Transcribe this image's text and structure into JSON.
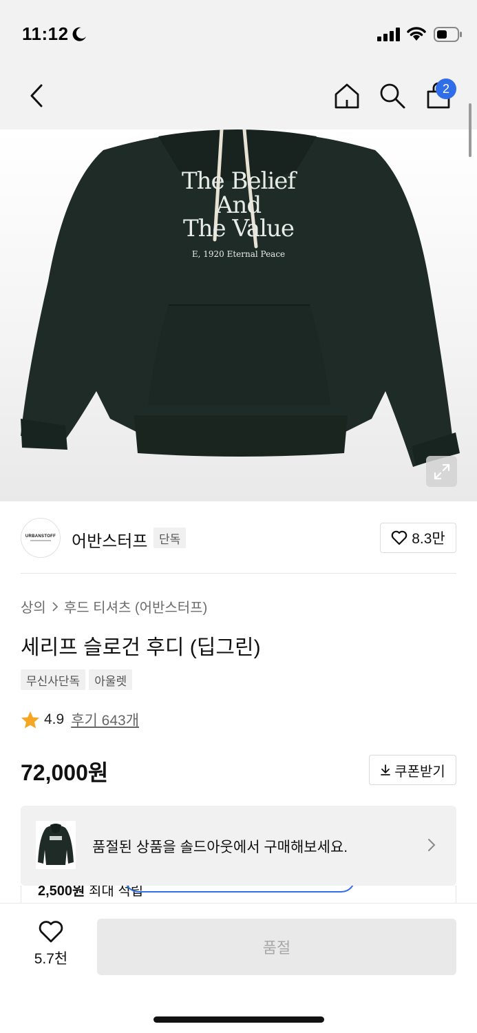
{
  "status_bar": {
    "time": "11:12"
  },
  "cart": {
    "badge_count": "2"
  },
  "product_image": {
    "print_line_1": "The Belief",
    "print_line_2": "And",
    "print_line_3": "The Value",
    "print_line_4": "E, 1920 Eternal Peace"
  },
  "brand": {
    "logo_text": "URBANSTOFF",
    "name": "어반스터프",
    "tag": "단독",
    "like_count": "8.3만"
  },
  "breadcrumb": {
    "category": "상의",
    "subcategory": "후드 티셔츠 (어반스터프)"
  },
  "product": {
    "title": "세리프 슬로건 후디 (딥그린)",
    "tags": [
      "무신사단독",
      "아울렛"
    ],
    "rating": "4.9",
    "review_link": "후기 643개",
    "price": "72,000원",
    "coupon_label": "쿠폰받기"
  },
  "soldout_banner": {
    "text": "품절된 상품을 솔드아웃에서 구매해보세요."
  },
  "peek": {
    "amount": "2,500원",
    "suffix": "최대 적립"
  },
  "bottom_bar": {
    "wish_count": "5.7천",
    "soldout_label": "품절"
  },
  "colors": {
    "accent_blue": "#2f6ee8",
    "hoodie_green": "#1f2b26",
    "star": "#f5a623"
  }
}
